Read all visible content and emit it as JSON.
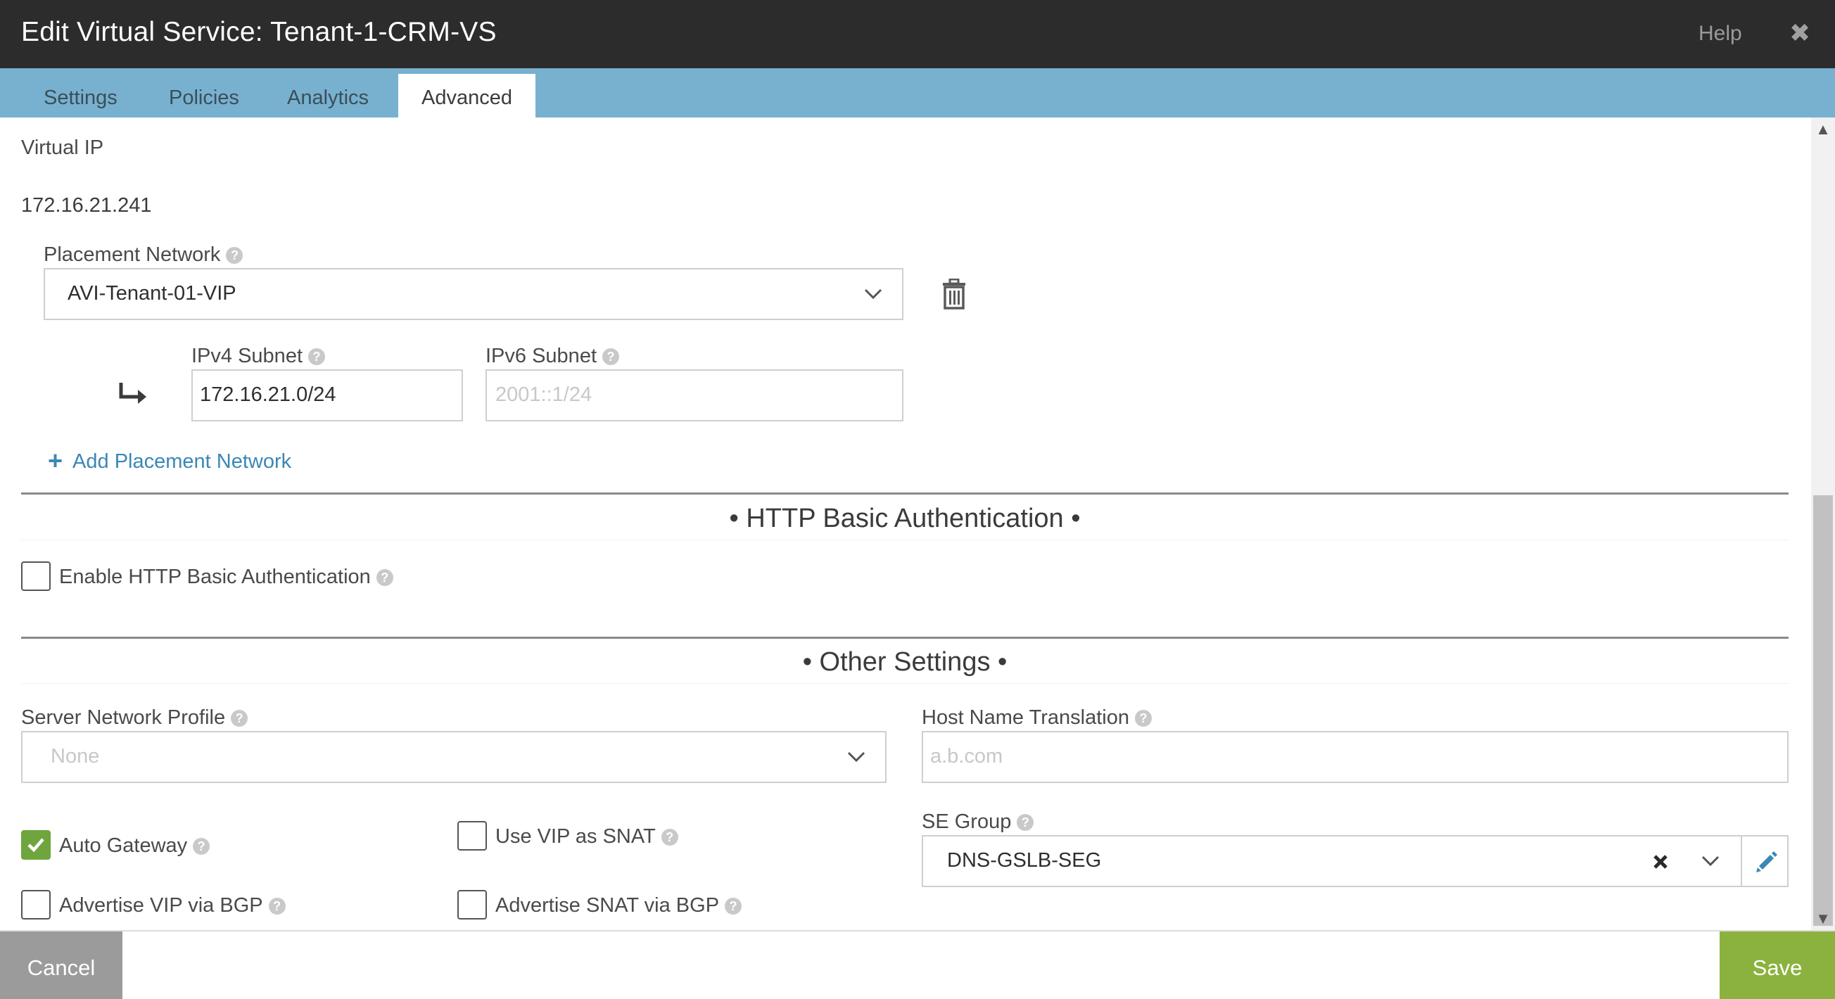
{
  "window": {
    "title": "Edit Virtual Service: Tenant-1-CRM-VS",
    "help_label": "Help",
    "close_glyph": "✖"
  },
  "tabs": [
    {
      "label": "Settings",
      "active": false
    },
    {
      "label": "Policies",
      "active": false
    },
    {
      "label": "Analytics",
      "active": false
    },
    {
      "label": "Advanced",
      "active": true
    }
  ],
  "vip": {
    "label": "Virtual IP",
    "address": "172.16.21.241"
  },
  "placement": {
    "label": "Placement Network",
    "value": "AVI-Tenant-01-VIP",
    "ipv4_label": "IPv4 Subnet",
    "ipv4_value": "172.16.21.0/24",
    "ipv6_label": "IPv6 Subnet",
    "ipv6_placeholder": "2001::1/24",
    "add_label": "Add Placement Network"
  },
  "http_auth": {
    "section_title": "• HTTP Basic Authentication •",
    "enable_label": "Enable HTTP Basic Authentication",
    "enabled": false
  },
  "other": {
    "section_title": "• Other Settings •",
    "server_profile_label": "Server Network Profile",
    "server_profile_placeholder": "None",
    "host_translation_label": "Host Name Translation",
    "host_translation_placeholder": "a.b.com",
    "se_group_label": "SE Group",
    "se_group_value": "DNS-GSLB-SEG",
    "auto_gateway_label": "Auto Gateway",
    "auto_gateway_checked": true,
    "use_vip_snat_label": "Use VIP as SNAT",
    "use_vip_snat_checked": false,
    "advertise_vip_label": "Advertise VIP via BGP",
    "advertise_vip_checked": false,
    "advertise_snat_label": "Advertise SNAT via BGP",
    "advertise_snat_checked": false
  },
  "footer": {
    "cancel_label": "Cancel",
    "save_label": "Save"
  },
  "colors": {
    "titlebar": "#2c2c2c",
    "tabbar": "#78b1cf",
    "link": "#3b87b5",
    "check": "#6fa53d",
    "save": "#8bb23e",
    "cancel": "#9b9b9b"
  }
}
